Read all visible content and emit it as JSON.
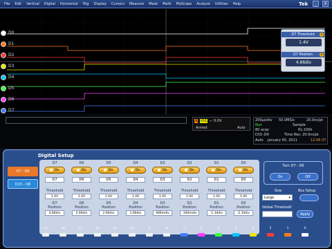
{
  "menu": {
    "items": [
      "File",
      "Edit",
      "Vertical",
      "Digital",
      "Horizontal",
      "Trig",
      "Display",
      "Cursors",
      "Measure",
      "Mask",
      "Math",
      "MyScope",
      "Analyze",
      "Utilities",
      "Help"
    ],
    "brand": "Tek",
    "window_buttons": [
      "_",
      "X"
    ]
  },
  "channels": [
    "D0",
    "D1",
    "D2",
    "D3",
    "D4",
    "D5",
    "D6",
    "D7"
  ],
  "d7_popup": {
    "threshold_label": "D7 Threshold",
    "threshold_value": "1.4V",
    "position_label": "D7 Position",
    "position_value": "4.66div",
    "knob_a": "a",
    "knob_b": "b"
  },
  "readouts": {
    "trigger_channel": "A",
    "trigger_level_box": "ch1",
    "trigger_slope": "0.0V",
    "armed": "Armed",
    "auto": "Auto",
    "timebase": "200µs/div",
    "sample_rate": "50.0MS/s",
    "pts": "20.0ns/pt",
    "run": "Run",
    "sample": "Sample",
    "acqs": "80 acqs",
    "rl": "RL:100k",
    "digital": "D15–D0",
    "timeres": "Time Res: 20.0ns/pt",
    "auto2": "Auto",
    "date": "January 05, 2011",
    "time": "12:06:37"
  },
  "setup": {
    "title": "Digital Setup",
    "side_buttons": [
      "D7 - D0",
      "D15 - D8"
    ],
    "columns": [
      {
        "name": "D7",
        "on": "On",
        "sel": "D7",
        "threshold": "1.4V",
        "position_label": "D7\nPosition",
        "position": "4.66div"
      },
      {
        "name": "D6",
        "on": "On",
        "sel": "D6",
        "threshold": "1.4V",
        "position_label": "D6\nPosition",
        "position": "2.66div"
      },
      {
        "name": "D5",
        "on": "On",
        "sel": "D5",
        "threshold": "1.4V",
        "position_label": "D5\nPosition",
        "position": "2.66div"
      },
      {
        "name": "D4",
        "on": "On",
        "sel": "D4",
        "threshold": "1.4V",
        "position_label": "D4\nPosition",
        "position": "1.66div"
      },
      {
        "name": "D3",
        "on": "On",
        "sel": "D3",
        "threshold": "1.4V",
        "position_label": "D3\nPosition",
        "position": "466mdiv"
      },
      {
        "name": "D2",
        "on": "On",
        "sel": "D2",
        "threshold": "1.4V",
        "position_label": "D2\nPosition",
        "position": "-340mdiv"
      },
      {
        "name": "D1",
        "on": "On",
        "sel": "D1",
        "threshold": "1.4V",
        "position_label": "D1\nPosition",
        "position": "-1.34div"
      },
      {
        "name": "D0",
        "on": "On",
        "sel": "D0",
        "threshold": "1.4V",
        "position_label": "D0\nPosition",
        "position": "-2.34div"
      }
    ],
    "threshold_label": "Threshold",
    "turn_label": "Turn D7 - D0",
    "turn_on": "On",
    "turn_off": "Off",
    "size_label": "Size",
    "size_value": "Large",
    "bus_setup": "Bus Setup",
    "global_threshold": "Global Threshold",
    "apply": "Apply",
    "footer": [
      "15",
      "14",
      "13",
      "12",
      "11",
      "10",
      "9",
      "8",
      "7",
      "6",
      "5",
      "4",
      "3",
      "2",
      "1",
      "0"
    ]
  },
  "colors": {
    "trace_d0": "#ffffff",
    "trace_d1": "#ff7a1a",
    "trace_d2": "#ff3a3a",
    "trace_d3": "#e8e800",
    "trace_d4": "#00c8ff",
    "trace_d5": "#40ff40",
    "trace_d6": "#ff40ff",
    "trace_d7": "#4080ff"
  }
}
